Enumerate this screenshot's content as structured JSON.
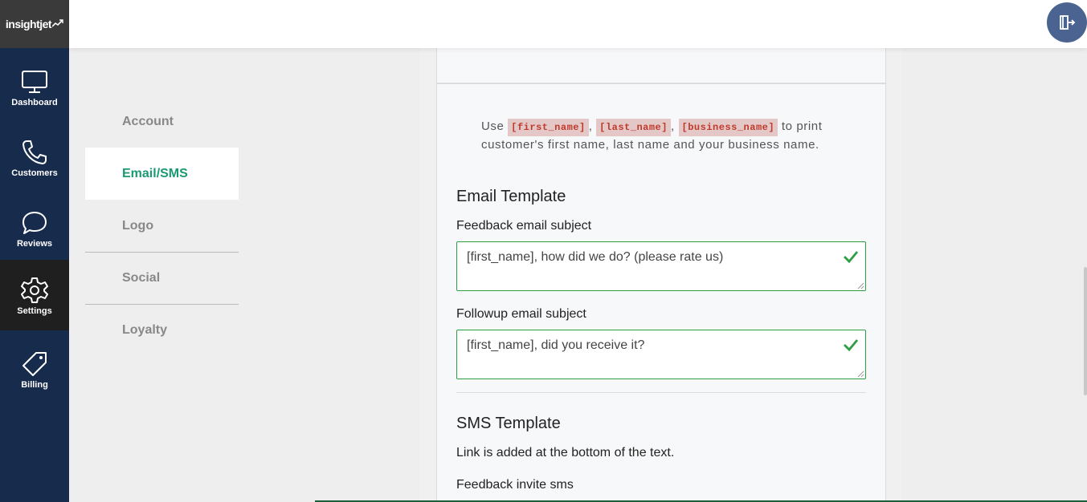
{
  "brand": {
    "name": "insightjet",
    "mark": "⚡"
  },
  "sidebar": {
    "items": [
      {
        "label": "Dashboard",
        "icon": "monitor-icon"
      },
      {
        "label": "Customers",
        "icon": "phone-icon"
      },
      {
        "label": "Reviews",
        "icon": "chat-bubble-icon"
      },
      {
        "label": "Settings",
        "icon": "gear-icon"
      },
      {
        "label": "Billing",
        "icon": "tag-icon"
      }
    ],
    "active": "Settings"
  },
  "topbar": {
    "logout_icon": "logout-icon"
  },
  "subnav": {
    "items": [
      {
        "label": "Account"
      },
      {
        "label": "Email/SMS"
      },
      {
        "label": "Logo"
      },
      {
        "label": "Social"
      },
      {
        "label": "Loyalty"
      }
    ],
    "active": "Email/SMS"
  },
  "hint": {
    "prefix": "Use",
    "token1": "[first_name]",
    "sep1": ",",
    "token2": "[last_name]",
    "sep2": ",",
    "token3": "[business_name]",
    "suffix": "to print customer's first name, last name and your business name."
  },
  "email_template": {
    "title": "Email Template",
    "feedback_label": "Feedback email subject",
    "feedback_value": "[first_name], how did we do? (please rate us)",
    "followup_label": "Followup email subject",
    "followup_value": "[first_name], did you receive it?"
  },
  "sms_template": {
    "title": "SMS Template",
    "note": "Link is added at the bottom of the text.",
    "invite_label": "Feedback invite sms"
  },
  "colors": {
    "sidebar": "#172b4d",
    "accent": "#1a9a73",
    "valid_border": "#2e9e44",
    "token_bg": "#e4c8c8",
    "token_text": "#c0392b",
    "logout_button": "#4a6390"
  }
}
